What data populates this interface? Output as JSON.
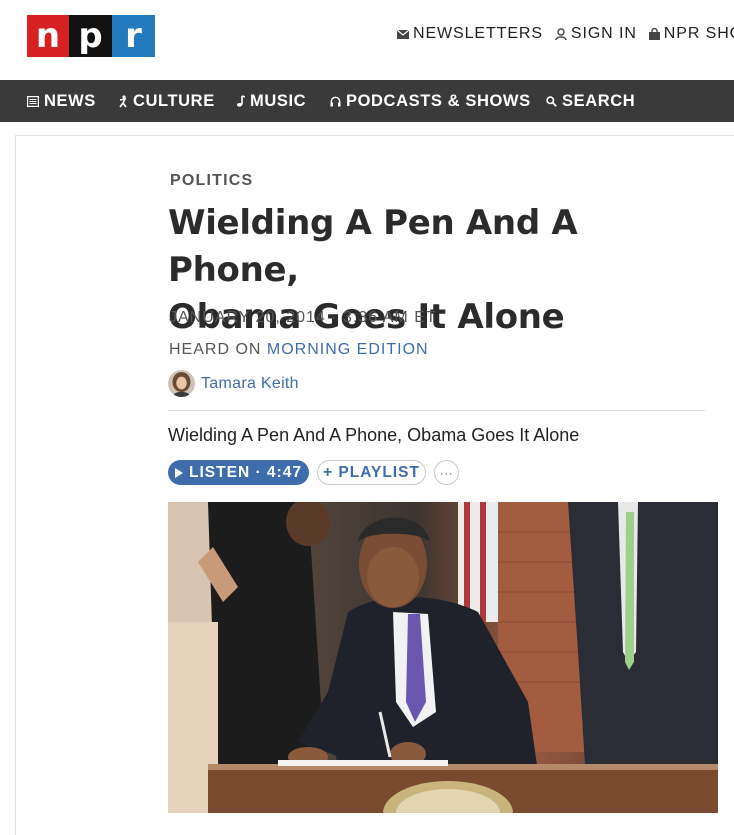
{
  "brand": {
    "letters": [
      "n",
      "p",
      "r"
    ],
    "colors": [
      "#d62021",
      "#111111",
      "#237bbd"
    ]
  },
  "utility_nav": [
    {
      "label": "NEWSLETTERS",
      "icon": "mail-icon"
    },
    {
      "label": "SIGN IN",
      "icon": "user-icon"
    },
    {
      "label": "NPR SHOP",
      "icon": "bag-icon"
    }
  ],
  "main_nav": [
    {
      "label": "NEWS",
      "icon": "news-icon"
    },
    {
      "label": "CULTURE",
      "icon": "culture-icon"
    },
    {
      "label": "MUSIC",
      "icon": "music-note-icon"
    },
    {
      "label": "PODCASTS & SHOWS",
      "icon": "headphones-icon"
    },
    {
      "label": "SEARCH",
      "icon": "search-icon"
    }
  ],
  "article": {
    "slug": "POLITICS",
    "headline_line1": "Wielding A Pen And A Phone,",
    "headline_line2": "Obama Goes It Alone",
    "dateline": "JANUARY 20, 2014 · 3:36 AM ET",
    "heard_on_prefix": "HEARD ON",
    "program": "MORNING EDITION",
    "author": "Tamara Keith",
    "audio_title": "Wielding A Pen And A Phone, Obama Goes It Alone",
    "listen_label": "LISTEN · 4:47",
    "playlist_label": "+ PLAYLIST",
    "more_label": "···"
  },
  "colors": {
    "accent": "#3f6dab",
    "nav_bg": "#3a3a3a"
  }
}
